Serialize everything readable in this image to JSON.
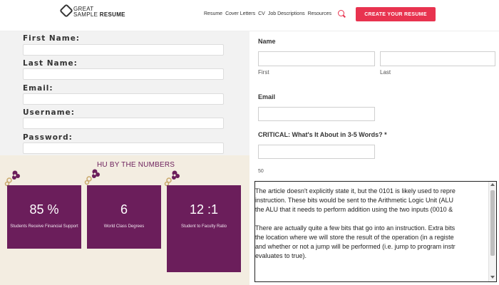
{
  "header": {
    "logo_line1": "GREAT",
    "logo_line2": "SAMPLE",
    "logo_line3": "RESUME",
    "nav": [
      "Resume",
      "Cover Letters",
      "CV",
      "Job Descriptions",
      "Resources"
    ],
    "cta_label": "CREATE YOUR RESUME",
    "icon": "search-icon"
  },
  "left_form": {
    "fields": [
      "First Name:",
      "Last Name:",
      "Email:",
      "Username:",
      "Password:"
    ]
  },
  "numbers": {
    "title": "HU BY THE NUMBERS",
    "cards": [
      {
        "value": "85 %",
        "label": "Students Receive Financial Support"
      },
      {
        "value": "6",
        "label": "World Class Degrees"
      },
      {
        "value": "12 :1",
        "label": "Student to Faculty Ratio"
      }
    ],
    "colors": {
      "card": "#6b1e5b",
      "background": "#f3ede1"
    }
  },
  "right_form": {
    "name_label": "Name",
    "first_label": "First",
    "last_label": "Last",
    "email_label": "Email",
    "critical_label": "CRITICAL: What's It About in 3-5 Words? *",
    "char_count": "50"
  },
  "article": {
    "lines_p1": [
      "The article doesn't explicitly state it, but the 0101 is likely used to repre",
      "instruction. These bits would be sent to the Arithmetic Logic Unit (ALU",
      "the ALU that it needs to perform addition using the two inputs (0010 &"
    ],
    "lines_p2": [
      "There are actually quite a few bits that go into an instruction. Extra bits",
      "the location where we will store the result of the operation (in a registe",
      "and whether or not a jump will be performed (i.e. jump to program instr",
      "evaluates to true)."
    ]
  }
}
